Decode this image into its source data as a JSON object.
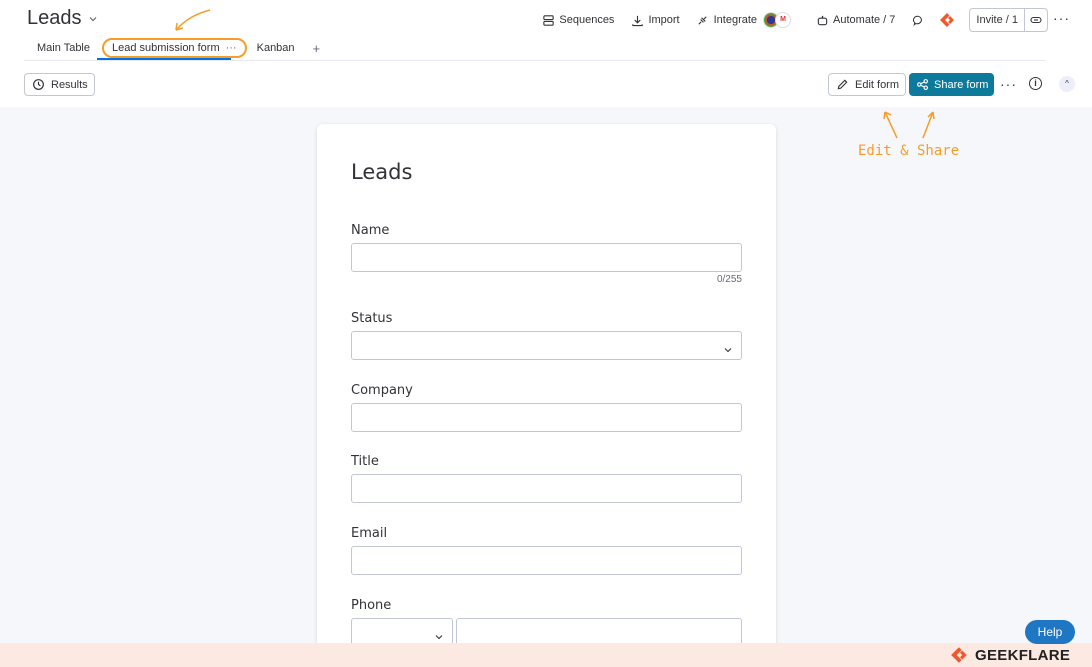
{
  "board": {
    "title": "Leads"
  },
  "tabs": [
    {
      "label": "Main Table"
    },
    {
      "label": "Lead submission form",
      "more": "···"
    },
    {
      "label": "Kanban"
    }
  ],
  "tab_add": "+",
  "top_actions": {
    "sequences": "Sequences",
    "import": "Import",
    "integrate": "Integrate",
    "automate": "Automate / 7",
    "invite": "Invite / 1",
    "more": "···"
  },
  "toolbar": {
    "results": "Results",
    "edit_form": "Edit form",
    "share_form": "Share form",
    "more": "···",
    "info": "i",
    "collapse": "^"
  },
  "form": {
    "title": "Leads",
    "fields": {
      "name": {
        "label": "Name",
        "counter": "0/255"
      },
      "status": {
        "label": "Status"
      },
      "company": {
        "label": "Company"
      },
      "title": {
        "label": "Title"
      },
      "email": {
        "label": "Email"
      },
      "phone": {
        "label": "Phone"
      }
    }
  },
  "annotation": {
    "text": "Edit & Share"
  },
  "help": "Help",
  "brand": "GEEKFLARE",
  "colors": {
    "accent": "#0e7a9b",
    "annotation": "#f59d29",
    "help": "#1f76c2",
    "brand_orange": "#f1572a"
  }
}
